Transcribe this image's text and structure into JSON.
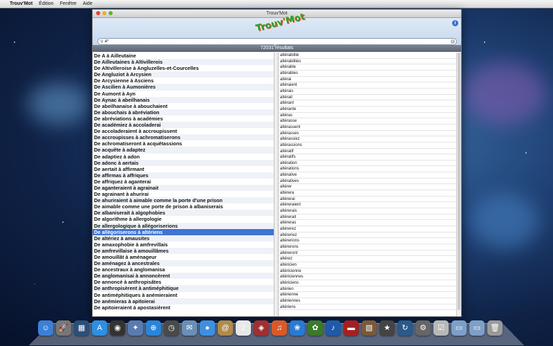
{
  "menubar": {
    "app": "Trouv'Mot",
    "items": [
      "Édition",
      "Fenêtre",
      "Aide"
    ]
  },
  "window": {
    "title": "Trouv'Mot",
    "logo": "Trouv'Mot",
    "search_value": "a*",
    "count_hint": "a*",
    "count": "72031 résultats"
  },
  "left_list": [
    "De A à Ailleutaine",
    "De Ailleutaines à Altivillerois",
    "De Altivilleroise à Angluzelles-et-Courcelles",
    "De Angluziot à Arcysien",
    "De Arcysienne à Asciens",
    "De Ascilien à Aumonières",
    "De Aumont à Ayn",
    "De Aynac à abeilhanais",
    "De abeilhanaise à abouchaient",
    "De abouchais à abréviation",
    "De abréviations à académies",
    "De académiez à accoladerai",
    "De accoladeraient à accroupissent",
    "De accroupisses à achromatiserons",
    "De achromatiseront à acquêtassions",
    "De acquête à adaptez",
    "De adaptiez à adon",
    "De adonc à aertais",
    "De aertait à affirmant",
    "De affirmas à affriques",
    "De affriquez à aganterai",
    "De aganteraient à agrainait",
    "De agrainant à ahurirai",
    "De ahuriraient à aimable comme la porte d'une prison",
    "De aimable comme une porte de prison à albaniserais",
    "De albaniserait à algophobies",
    "De algorithme à allergologie",
    "De allergologique à allégoriserions",
    "De allégoriserons à altériens",
    "De altériez à amausites",
    "De amaxophobie à amfrevillais",
    "De amfrevillaise à amouillâmes",
    "De amouillât à aménageur",
    "De aménagez à ancestrales",
    "De ancestraux à anglomanisa",
    "De anglomanisai à annoncèrent",
    "De annoncé à anthropisâtes",
    "De anthropisèrent à antiméphitique",
    "De antiméphitiques à anémieraient",
    "De anémieras à apitoierai",
    "De apitoieraient à apostasièrent"
  ],
  "selected_index": 28,
  "right_list": [
    "altérabilité",
    "altérabilités",
    "altérable",
    "altérables",
    "altérai",
    "altéraient",
    "altérais",
    "altérait",
    "altérant",
    "altérante",
    "altéras",
    "altérasse",
    "altérassent",
    "altérasses",
    "altérassiez",
    "altérassions",
    "altératif",
    "altératifs",
    "altération",
    "altérations",
    "altérative",
    "altératives",
    "altérer",
    "altérera",
    "altérerai",
    "altéreraient",
    "altérerais",
    "altérerait",
    "altéreras",
    "altérerez",
    "altéreriez",
    "altérerions",
    "altérerons",
    "altéreront",
    "altérez",
    "altéricien",
    "altéricienne",
    "altériciennes",
    "altériciens",
    "altérien",
    "altérienne",
    "altériennes",
    "altériens"
  ],
  "dock": [
    {
      "name": "finder-icon",
      "glyph": "☺",
      "color": "#3d7fd6"
    },
    {
      "name": "launchpad-icon",
      "glyph": "🚀",
      "color": "#777"
    },
    {
      "name": "mission-control-icon",
      "glyph": "▦",
      "color": "#2c4f7a"
    },
    {
      "name": "app-store-icon",
      "glyph": "A",
      "color": "#2e8fe0"
    },
    {
      "name": "dashboard-icon",
      "glyph": "◉",
      "color": "#333"
    },
    {
      "name": "preview-icon",
      "glyph": "✦",
      "color": "#5a7bb0"
    },
    {
      "name": "safari-icon",
      "glyph": "⊕",
      "color": "#2a84d8"
    },
    {
      "name": "facetime-icon",
      "glyph": "◷",
      "color": "#4a4a4a"
    },
    {
      "name": "mail-icon",
      "glyph": "✉",
      "color": "#6b8fb5"
    },
    {
      "name": "messages-icon",
      "glyph": "●",
      "color": "#3f8fe0"
    },
    {
      "name": "contacts-icon",
      "glyph": "@",
      "color": "#b08a4a"
    },
    {
      "name": "calendar-icon",
      "glyph": "2",
      "color": "#e8e8e8"
    },
    {
      "name": "photo-booth-icon",
      "glyph": "◈",
      "color": "#a03030"
    },
    {
      "name": "itunes-icon",
      "glyph": "♫",
      "color": "#d85a2a"
    },
    {
      "name": "iphoto-icon",
      "glyph": "❀",
      "color": "#2a7ad0"
    },
    {
      "name": "garageband-icon",
      "glyph": "✿",
      "color": "#3a7a2a"
    },
    {
      "name": "itunes-store-icon",
      "glyph": "♪",
      "color": "#1f5aaa"
    },
    {
      "name": "book-icon",
      "glyph": "▬",
      "color": "#a52020"
    },
    {
      "name": "iphoto-album-icon",
      "glyph": "▧",
      "color": "#7a5a3a"
    },
    {
      "name": "imovie-icon",
      "glyph": "★",
      "color": "#444"
    },
    {
      "name": "time-machine-icon",
      "glyph": "↻",
      "color": "#2a5a8a"
    },
    {
      "name": "system-preferences-icon",
      "glyph": "⚙",
      "color": "#666"
    },
    {
      "name": "trouvmot-icon",
      "glyph": "☑",
      "color": "#b8b8b8"
    },
    {
      "name": "applications-folder-icon",
      "glyph": "▭",
      "color": "#7ea0c8"
    },
    {
      "name": "documents-folder-icon",
      "glyph": "▭",
      "color": "#7ea0c8"
    },
    {
      "name": "trash-icon",
      "glyph": "🗑",
      "color": "#9a9a9a"
    }
  ]
}
